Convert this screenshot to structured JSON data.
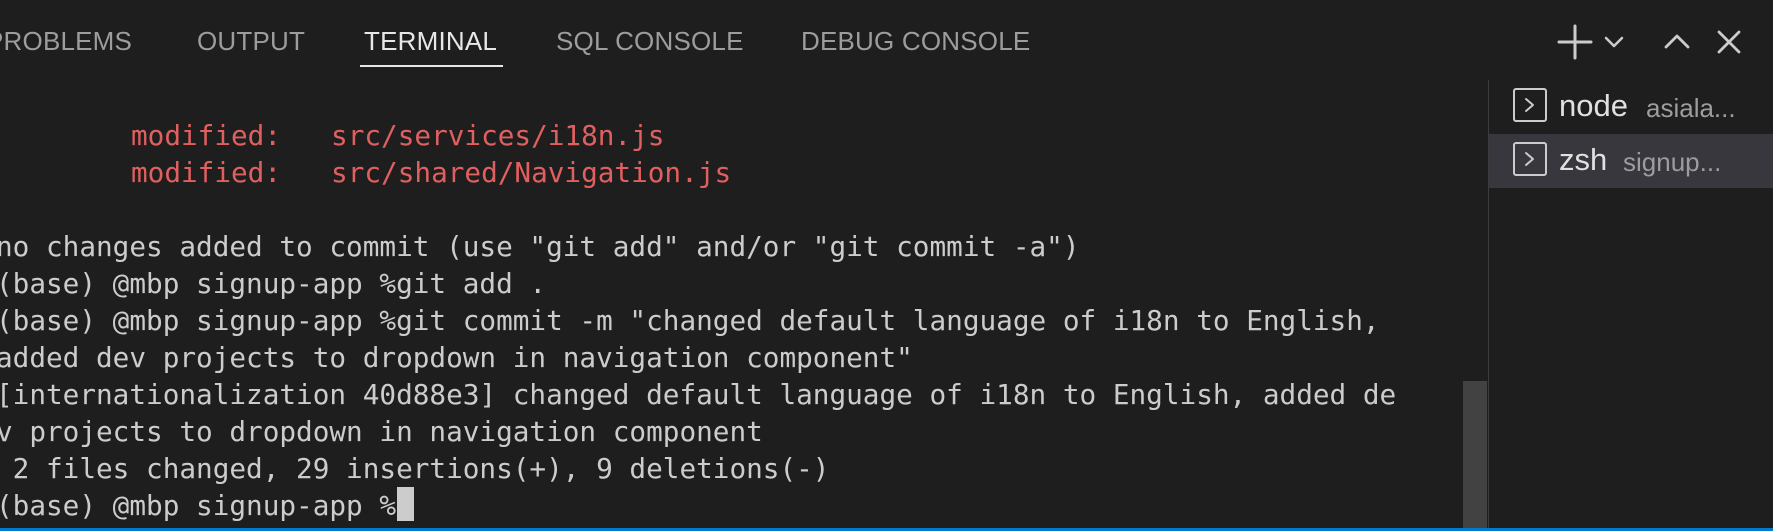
{
  "tabs": [
    {
      "label": "PROBLEMS"
    },
    {
      "label": "OUTPUT"
    },
    {
      "label": "TERMINAL"
    },
    {
      "label": "SQL CONSOLE"
    },
    {
      "label": "DEBUG CONSOLE"
    }
  ],
  "active_tab": "TERMINAL",
  "actions": {
    "new_terminal_icon": "plus-icon",
    "launch_profile_icon": "chevron-down-icon",
    "maximize_icon": "chevron-up-icon",
    "close_icon": "close-icon"
  },
  "terminal": {
    "lines": [
      {
        "label": "modified:",
        "path": "src/services/i18n.js"
      },
      {
        "label": "modified:",
        "path": "src/shared/Navigation.js"
      },
      {
        "text": "no changes added to commit (use \"git add\" and/or \"git commit -a\")"
      },
      {
        "text": "(base) @mbp signup-app %git add ."
      },
      {
        "text": "(base) @mbp signup-app %git commit -m \"changed default language of i18n to English,"
      },
      {
        "text": "added dev projects to dropdown in navigation component\""
      },
      {
        "text": "[internationalization 40d88e3] changed default language of i18n to English, added de"
      },
      {
        "text": "v projects to dropdown in navigation component"
      },
      {
        "text": " 2 files changed, 29 insertions(+), 9 deletions(-)"
      },
      {
        "text": "(base) @mbp signup-app %"
      }
    ]
  },
  "terminal_list": [
    {
      "name": "node",
      "description": "asiala...",
      "selected": false,
      "icon": "terminal-icon"
    },
    {
      "name": "zsh",
      "description": "signup...",
      "selected": true,
      "icon": "terminal-icon"
    }
  ],
  "colors": {
    "background": "#1e1e1e",
    "modified_text": "#e05f5f",
    "text": "#cccccc",
    "selected_item": "#37373d",
    "accent": "#007acc"
  }
}
